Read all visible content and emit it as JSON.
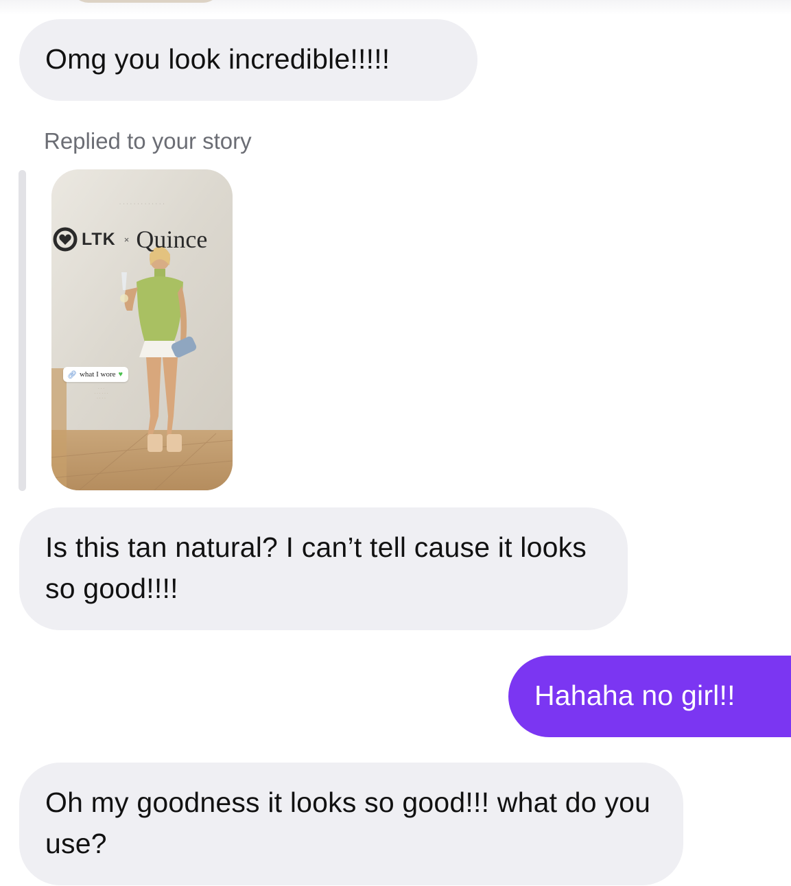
{
  "messages": [
    {
      "direction": "incoming",
      "text": "Omg you look incredible!!!!!"
    },
    {
      "direction": "incoming",
      "text": "Is this tan natural? I can’t tell cause it looks so good!!!!"
    },
    {
      "direction": "outgoing",
      "text": "Hahaha no girl!!"
    },
    {
      "direction": "incoming",
      "text": "Oh my goodness it looks so good!!! what do you use?"
    }
  ],
  "story_reply": {
    "label": "Replied to your story",
    "story": {
      "brand_left": "LTK",
      "brand_separator": "×",
      "brand_right": "Quince",
      "sticker_text": "what I wore",
      "sticker_icon": "link-icon",
      "sticker_emoji": "green-heart-icon"
    }
  },
  "colors": {
    "incoming_bubble": "#efeff3",
    "outgoing_bubble": "#7b36f2",
    "meta_text": "#6b6d74"
  }
}
